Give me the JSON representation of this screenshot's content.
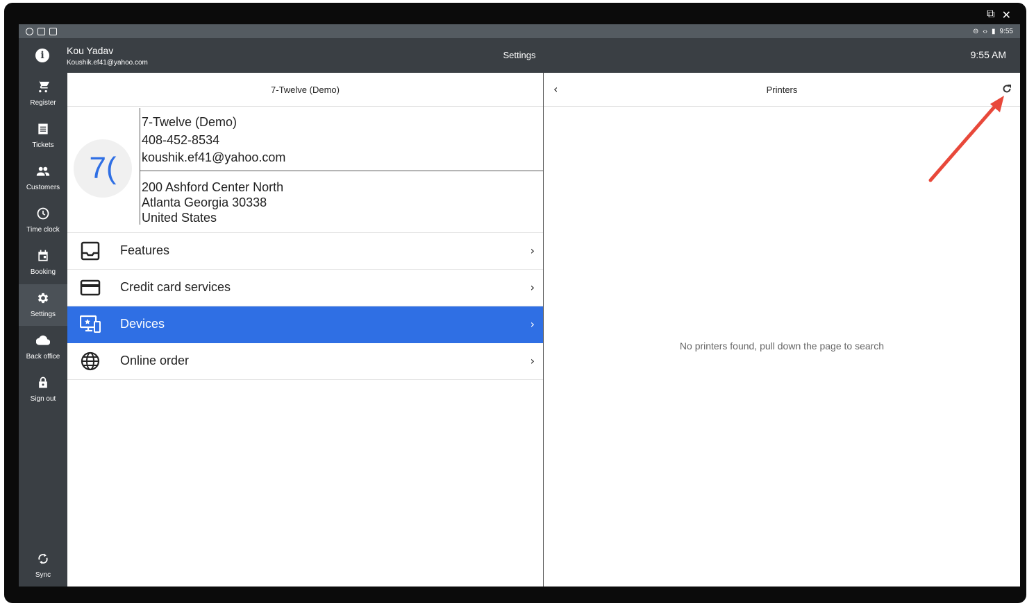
{
  "statusbar": {
    "time": "9:55"
  },
  "appbar": {
    "user_name": "Kou Yadav",
    "user_email": "Koushik.ef41@yahoo.com",
    "title": "Settings",
    "time": "9:55 AM"
  },
  "sidebar": {
    "items": [
      {
        "label": "Register",
        "icon": "cart-icon"
      },
      {
        "label": "Tickets",
        "icon": "receipt-icon"
      },
      {
        "label": "Customers",
        "icon": "people-icon"
      },
      {
        "label": "Time clock",
        "icon": "clock-icon"
      },
      {
        "label": "Booking",
        "icon": "calendar-icon"
      },
      {
        "label": "Settings",
        "icon": "gear-icon",
        "active": true
      },
      {
        "label": "Back office",
        "icon": "cloud-icon"
      },
      {
        "label": "Sign out",
        "icon": "lock-icon"
      }
    ],
    "sync_label": "Sync"
  },
  "left_pane": {
    "header": "7-Twelve (Demo)",
    "store": {
      "avatar_text": "7(",
      "name": "7-Twelve (Demo)",
      "phone": "408-452-8534",
      "email": "koushik.ef41@yahoo.com",
      "address1": "200 Ashford Center North",
      "address2": "Atlanta Georgia 30338",
      "country": "United States"
    },
    "menu": [
      {
        "label": "Features",
        "icon": "inbox-icon"
      },
      {
        "label": "Credit card services",
        "icon": "credit-card-icon"
      },
      {
        "label": "Devices",
        "icon": "devices-icon",
        "active": true
      },
      {
        "label": "Online order",
        "icon": "globe-icon"
      }
    ]
  },
  "right_pane": {
    "title": "Printers",
    "empty_message": "No printers found, pull down the page to search"
  },
  "colors": {
    "accent": "#2f6fe4",
    "appbar": "#3a3f44",
    "annotation_arrow": "#e8483a"
  }
}
